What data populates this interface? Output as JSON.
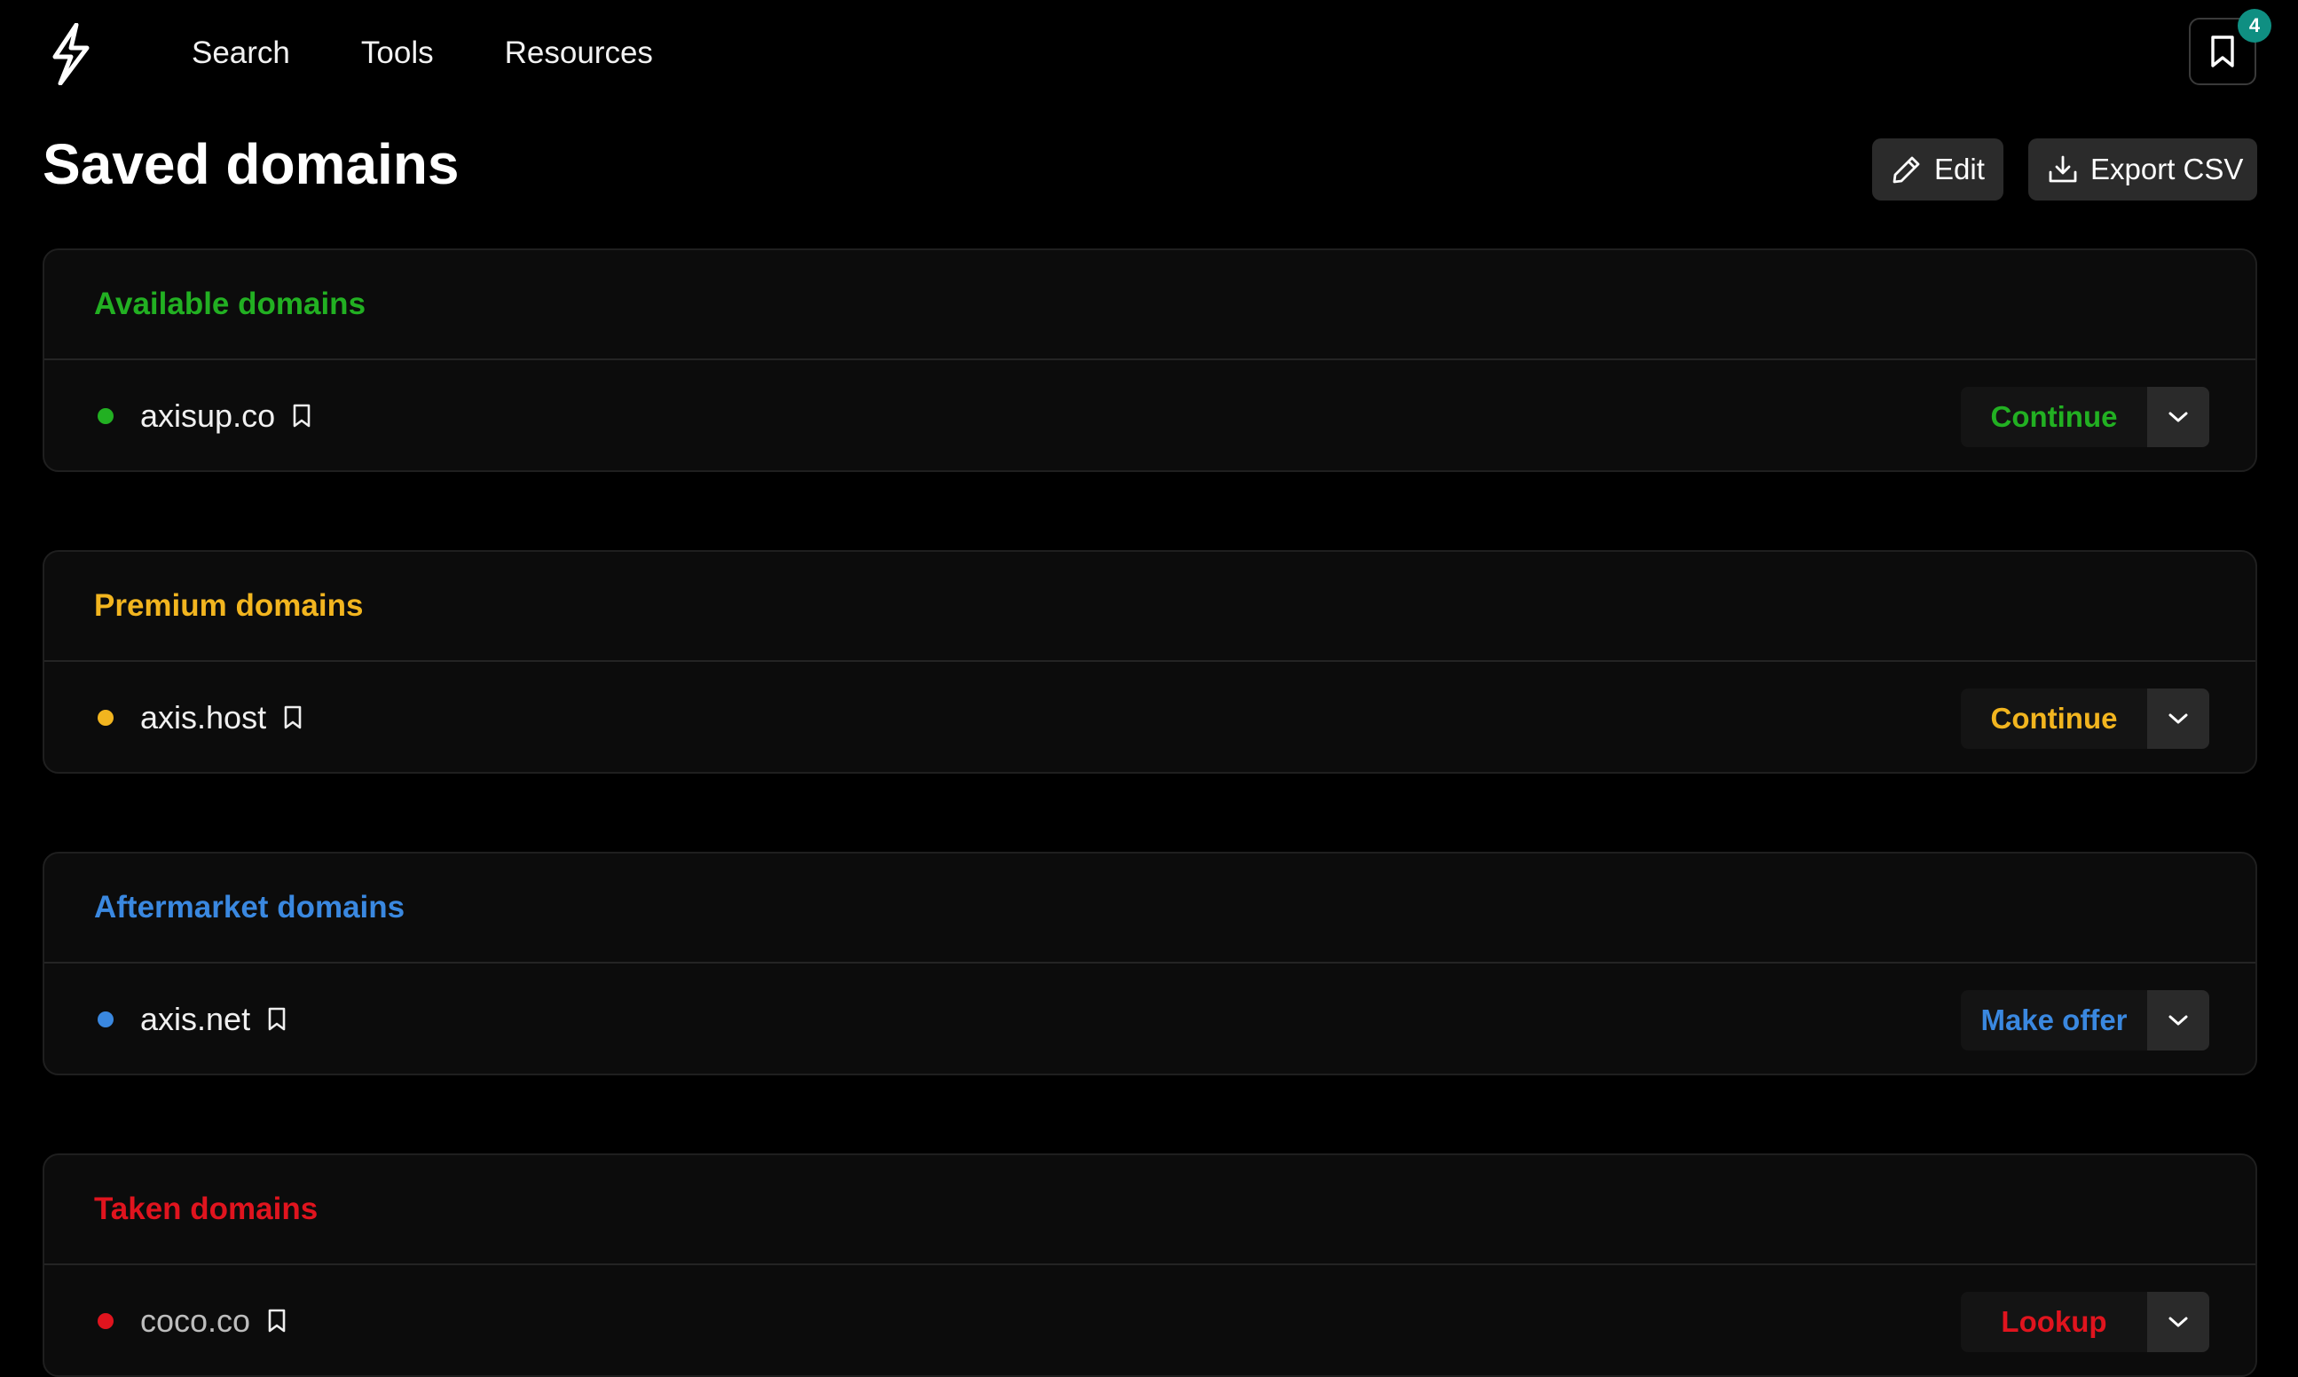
{
  "nav": {
    "links": [
      {
        "label": "Search"
      },
      {
        "label": "Tools"
      },
      {
        "label": "Resources"
      }
    ],
    "saved_count": "4"
  },
  "header": {
    "title": "Saved domains",
    "edit_label": "Edit",
    "export_label": "Export CSV"
  },
  "groups": [
    {
      "title": "Available domains",
      "color": "#22b022",
      "domain": "axisup.co",
      "action": "Continue"
    },
    {
      "title": "Premium domains",
      "color": "#f2b51f",
      "domain": "axis.host",
      "action": "Continue"
    },
    {
      "title": "Aftermarket domains",
      "color": "#3a88e0",
      "domain": "axis.net",
      "action": "Make offer"
    },
    {
      "title": "Taken domains",
      "color": "#e0141e",
      "domain": "coco.co",
      "action": "Lookup"
    }
  ]
}
